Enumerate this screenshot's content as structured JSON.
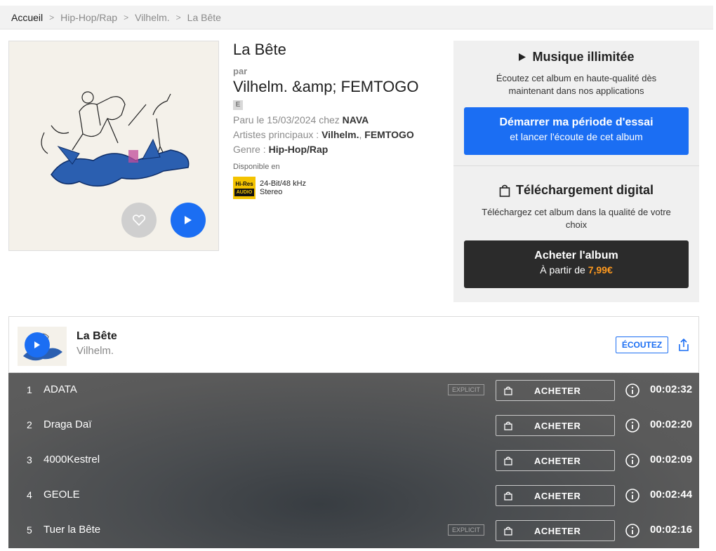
{
  "breadcrumb": {
    "items": [
      "Accueil",
      "Hip-Hop/Rap",
      "Vilhelm.",
      "La Bête"
    ],
    "separator": ">"
  },
  "album": {
    "title": "La Bête",
    "by_label": "par",
    "artist_display": "Vilhelm. &amp; FEMTOGO",
    "explicit_marker": "E",
    "release_prefix": "Paru le 15/03/2024 chez",
    "label": "NAVA",
    "main_artists_prefix": "Artistes principaux :",
    "main_artists": [
      "Vilhelm.",
      "FEMTOGO"
    ],
    "genre_prefix": "Genre :",
    "genre": "Hip-Hop/Rap",
    "available_in": "Disponible en",
    "hires_badge_top": "Hi-Res",
    "hires_badge_bottom": "AUDIO",
    "quality_line1": "24-Bit/48 kHz",
    "quality_line2": "Stereo"
  },
  "streaming_offer": {
    "title": "Musique illimitée",
    "description": "Écoutez cet album en haute-qualité dès maintenant dans nos applications",
    "cta_line1": "Démarrer ma période d'essai",
    "cta_line2": "et lancer l'écoute de cet album"
  },
  "download_offer": {
    "title": "Téléchargement digital",
    "description": "Téléchargez cet album dans la qualité de votre choix",
    "cta_line1": "Acheter l'album",
    "cta_price_prefix": "À partir de",
    "price": "7,99€"
  },
  "player": {
    "title": "La Bête",
    "artist": "Vilhelm.",
    "listen_label": "ÉCOUTEZ"
  },
  "tracks": [
    {
      "num": "1",
      "title": "ADATA",
      "explicit": true,
      "explicit_label": "EXPLICIT",
      "buy_label": "ACHETER",
      "duration": "00:02:32"
    },
    {
      "num": "2",
      "title": "Draga Daï",
      "explicit": false,
      "explicit_label": "",
      "buy_label": "ACHETER",
      "duration": "00:02:20"
    },
    {
      "num": "3",
      "title": "4000Kestrel",
      "explicit": false,
      "explicit_label": "",
      "buy_label": "ACHETER",
      "duration": "00:02:09"
    },
    {
      "num": "4",
      "title": "GEOLE",
      "explicit": false,
      "explicit_label": "",
      "buy_label": "ACHETER",
      "duration": "00:02:44"
    },
    {
      "num": "5",
      "title": "Tuer la Bête",
      "explicit": true,
      "explicit_label": "EXPLICIT",
      "buy_label": "ACHETER",
      "duration": "00:02:16"
    }
  ],
  "colors": {
    "accent_blue": "#1b6ef3",
    "price_orange": "#ff9a1f",
    "dark_button": "#2b2b2b",
    "hires_yellow": "#f4c300"
  },
  "icons": [
    "play-icon",
    "heart-icon",
    "shopping-bag-icon",
    "info-icon",
    "share-icon",
    "chevron-right-icon"
  ]
}
